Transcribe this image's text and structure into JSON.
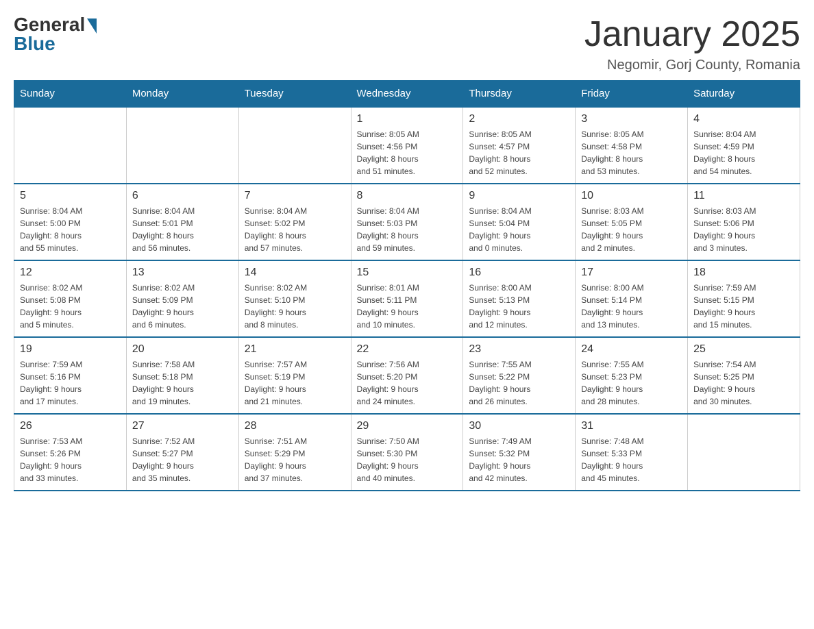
{
  "logo": {
    "general": "General",
    "blue": "Blue"
  },
  "title": "January 2025",
  "location": "Negomir, Gorj County, Romania",
  "weekdays": [
    "Sunday",
    "Monday",
    "Tuesday",
    "Wednesday",
    "Thursday",
    "Friday",
    "Saturday"
  ],
  "weeks": [
    [
      {
        "day": "",
        "info": ""
      },
      {
        "day": "",
        "info": ""
      },
      {
        "day": "",
        "info": ""
      },
      {
        "day": "1",
        "info": "Sunrise: 8:05 AM\nSunset: 4:56 PM\nDaylight: 8 hours\nand 51 minutes."
      },
      {
        "day": "2",
        "info": "Sunrise: 8:05 AM\nSunset: 4:57 PM\nDaylight: 8 hours\nand 52 minutes."
      },
      {
        "day": "3",
        "info": "Sunrise: 8:05 AM\nSunset: 4:58 PM\nDaylight: 8 hours\nand 53 minutes."
      },
      {
        "day": "4",
        "info": "Sunrise: 8:04 AM\nSunset: 4:59 PM\nDaylight: 8 hours\nand 54 minutes."
      }
    ],
    [
      {
        "day": "5",
        "info": "Sunrise: 8:04 AM\nSunset: 5:00 PM\nDaylight: 8 hours\nand 55 minutes."
      },
      {
        "day": "6",
        "info": "Sunrise: 8:04 AM\nSunset: 5:01 PM\nDaylight: 8 hours\nand 56 minutes."
      },
      {
        "day": "7",
        "info": "Sunrise: 8:04 AM\nSunset: 5:02 PM\nDaylight: 8 hours\nand 57 minutes."
      },
      {
        "day": "8",
        "info": "Sunrise: 8:04 AM\nSunset: 5:03 PM\nDaylight: 8 hours\nand 59 minutes."
      },
      {
        "day": "9",
        "info": "Sunrise: 8:04 AM\nSunset: 5:04 PM\nDaylight: 9 hours\nand 0 minutes."
      },
      {
        "day": "10",
        "info": "Sunrise: 8:03 AM\nSunset: 5:05 PM\nDaylight: 9 hours\nand 2 minutes."
      },
      {
        "day": "11",
        "info": "Sunrise: 8:03 AM\nSunset: 5:06 PM\nDaylight: 9 hours\nand 3 minutes."
      }
    ],
    [
      {
        "day": "12",
        "info": "Sunrise: 8:02 AM\nSunset: 5:08 PM\nDaylight: 9 hours\nand 5 minutes."
      },
      {
        "day": "13",
        "info": "Sunrise: 8:02 AM\nSunset: 5:09 PM\nDaylight: 9 hours\nand 6 minutes."
      },
      {
        "day": "14",
        "info": "Sunrise: 8:02 AM\nSunset: 5:10 PM\nDaylight: 9 hours\nand 8 minutes."
      },
      {
        "day": "15",
        "info": "Sunrise: 8:01 AM\nSunset: 5:11 PM\nDaylight: 9 hours\nand 10 minutes."
      },
      {
        "day": "16",
        "info": "Sunrise: 8:00 AM\nSunset: 5:13 PM\nDaylight: 9 hours\nand 12 minutes."
      },
      {
        "day": "17",
        "info": "Sunrise: 8:00 AM\nSunset: 5:14 PM\nDaylight: 9 hours\nand 13 minutes."
      },
      {
        "day": "18",
        "info": "Sunrise: 7:59 AM\nSunset: 5:15 PM\nDaylight: 9 hours\nand 15 minutes."
      }
    ],
    [
      {
        "day": "19",
        "info": "Sunrise: 7:59 AM\nSunset: 5:16 PM\nDaylight: 9 hours\nand 17 minutes."
      },
      {
        "day": "20",
        "info": "Sunrise: 7:58 AM\nSunset: 5:18 PM\nDaylight: 9 hours\nand 19 minutes."
      },
      {
        "day": "21",
        "info": "Sunrise: 7:57 AM\nSunset: 5:19 PM\nDaylight: 9 hours\nand 21 minutes."
      },
      {
        "day": "22",
        "info": "Sunrise: 7:56 AM\nSunset: 5:20 PM\nDaylight: 9 hours\nand 24 minutes."
      },
      {
        "day": "23",
        "info": "Sunrise: 7:55 AM\nSunset: 5:22 PM\nDaylight: 9 hours\nand 26 minutes."
      },
      {
        "day": "24",
        "info": "Sunrise: 7:55 AM\nSunset: 5:23 PM\nDaylight: 9 hours\nand 28 minutes."
      },
      {
        "day": "25",
        "info": "Sunrise: 7:54 AM\nSunset: 5:25 PM\nDaylight: 9 hours\nand 30 minutes."
      }
    ],
    [
      {
        "day": "26",
        "info": "Sunrise: 7:53 AM\nSunset: 5:26 PM\nDaylight: 9 hours\nand 33 minutes."
      },
      {
        "day": "27",
        "info": "Sunrise: 7:52 AM\nSunset: 5:27 PM\nDaylight: 9 hours\nand 35 minutes."
      },
      {
        "day": "28",
        "info": "Sunrise: 7:51 AM\nSunset: 5:29 PM\nDaylight: 9 hours\nand 37 minutes."
      },
      {
        "day": "29",
        "info": "Sunrise: 7:50 AM\nSunset: 5:30 PM\nDaylight: 9 hours\nand 40 minutes."
      },
      {
        "day": "30",
        "info": "Sunrise: 7:49 AM\nSunset: 5:32 PM\nDaylight: 9 hours\nand 42 minutes."
      },
      {
        "day": "31",
        "info": "Sunrise: 7:48 AM\nSunset: 5:33 PM\nDaylight: 9 hours\nand 45 minutes."
      },
      {
        "day": "",
        "info": ""
      }
    ]
  ]
}
